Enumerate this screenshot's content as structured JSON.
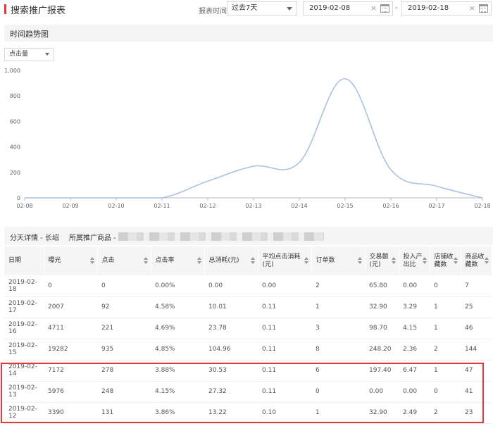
{
  "header": {
    "title": "搜索推广报表",
    "time_label": "报表时间",
    "range_select": "过去7天",
    "date_start": "2019-02-08",
    "date_end": "2019-02-18",
    "separator": "-",
    "clear_glyph": "×"
  },
  "trend": {
    "title": "时间趋势图",
    "metric_select": "点击量"
  },
  "chart_data": {
    "type": "line",
    "x": [
      "02-08",
      "02-09",
      "02-10",
      "02-11",
      "02-12",
      "02-13",
      "02-14",
      "02-15",
      "02-16",
      "02-17",
      "02-18"
    ],
    "series": [
      {
        "values": [
          0,
          0,
          0,
          0,
          131,
          248,
          278,
          935,
          221,
          92,
          0
        ]
      }
    ],
    "yticks": [
      "0",
      "200",
      "400",
      "600",
      "800",
      "1,000"
    ],
    "ylim": [
      0,
      1000
    ],
    "grid": false,
    "line_color": "#a9c2e4"
  },
  "detail": {
    "title": "分天详情 - 长绍",
    "product_label": "所属推广商品 -"
  },
  "table": {
    "headers": [
      "日期",
      "曝光",
      "点击",
      "点击率",
      "总消耗(元)",
      "平均点击消耗(元)",
      "订单数",
      "交易额(元)",
      "投入产出比",
      "店铺收藏数",
      "商品收藏数"
    ],
    "rows": [
      [
        "2019-02-18",
        "0",
        "0",
        "0.00%",
        "0.00",
        "0.00",
        "2",
        "65.80",
        "0.00",
        "0",
        "7"
      ],
      [
        "2019-02-17",
        "2007",
        "92",
        "4.58%",
        "10.01",
        "0.11",
        "1",
        "32.90",
        "3.29",
        "1",
        "25"
      ],
      [
        "2019-02-16",
        "4711",
        "221",
        "4.69%",
        "23.78",
        "0.11",
        "3",
        "98.70",
        "4.15",
        "1",
        "46"
      ],
      [
        "2019-02-15",
        "19282",
        "935",
        "4.85%",
        "104.96",
        "0.11",
        "8",
        "248.20",
        "2.36",
        "2",
        "144"
      ],
      [
        "2019-02-14",
        "7172",
        "278",
        "3.88%",
        "30.53",
        "0.11",
        "6",
        "197.40",
        "6.47",
        "1",
        "47"
      ],
      [
        "2019-02-13",
        "5976",
        "248",
        "4.15%",
        "27.32",
        "0.11",
        "0",
        "0.00",
        "0.00",
        "0",
        "41"
      ],
      [
        "2019-02-12",
        "3390",
        "131",
        "3.86%",
        "13.22",
        "0.10",
        "1",
        "32.90",
        "2.49",
        "2",
        "23"
      ]
    ]
  },
  "colors": {
    "accent": "#e4393c",
    "line": "#a9c2e4"
  }
}
